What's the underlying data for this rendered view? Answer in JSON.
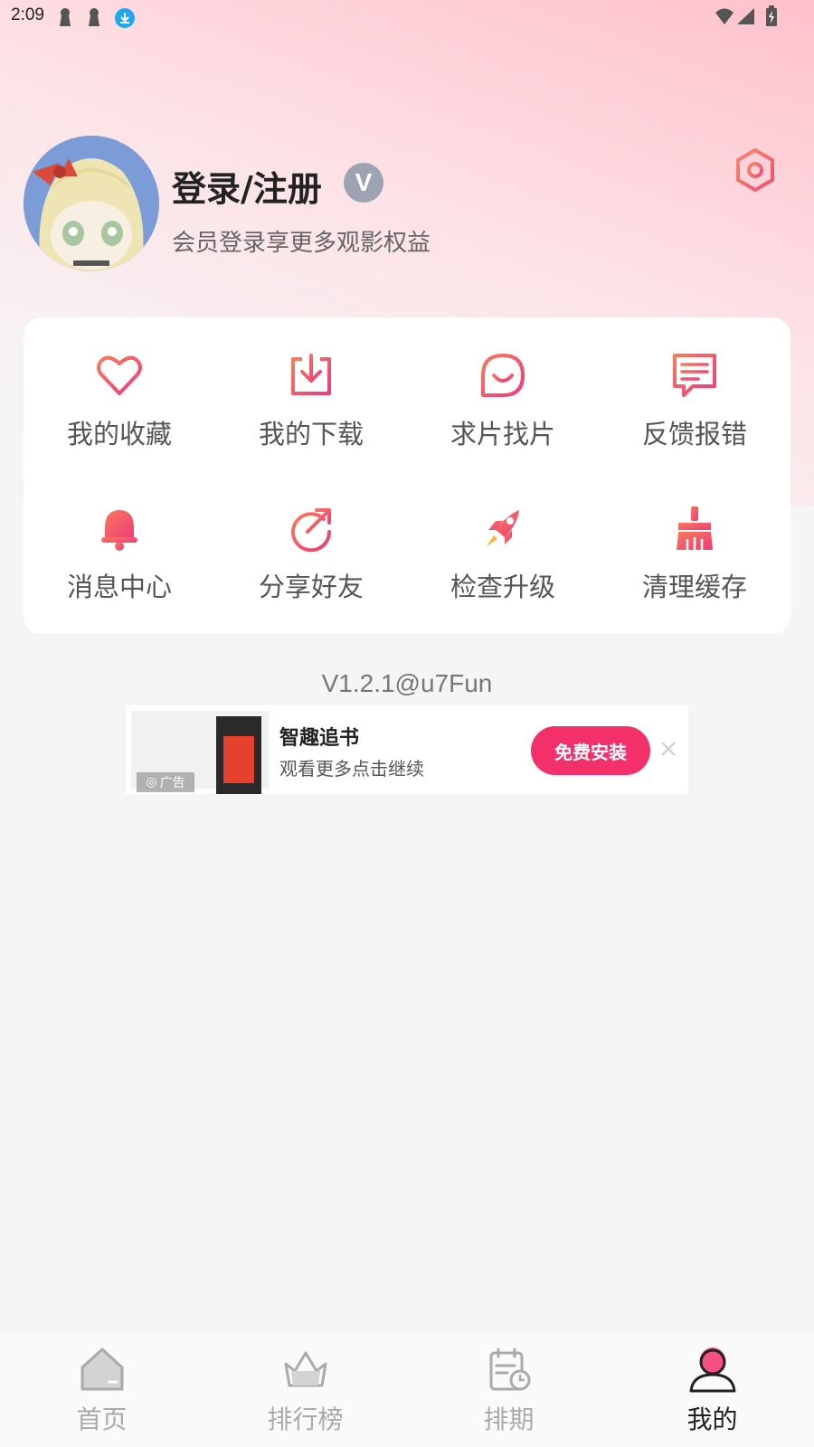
{
  "status_bar": {
    "time": "2:09"
  },
  "profile": {
    "login_label": "登录/注册",
    "vip_badge": "V",
    "subtitle": "会员登录享更多观影权益"
  },
  "menu": {
    "items": [
      {
        "label": "我的收藏",
        "icon": "heart-icon"
      },
      {
        "label": "我的下载",
        "icon": "download-icon"
      },
      {
        "label": "求片找片",
        "icon": "smile-chat-icon"
      },
      {
        "label": "反馈报错",
        "icon": "feedback-icon"
      },
      {
        "label": "消息中心",
        "icon": "bell-icon"
      },
      {
        "label": "分享好友",
        "icon": "share-icon"
      },
      {
        "label": "检查升级",
        "icon": "rocket-icon"
      },
      {
        "label": "清理缓存",
        "icon": "broom-icon"
      }
    ]
  },
  "version": "V1.2.1@u7Fun",
  "ad": {
    "tag": "广告",
    "title": "智趣追书",
    "description": "观看更多点击继续",
    "button": "免费安装"
  },
  "bottom_nav": {
    "items": [
      {
        "label": "首页",
        "icon": "home-icon",
        "active": false
      },
      {
        "label": "排行榜",
        "icon": "crown-icon",
        "active": false
      },
      {
        "label": "排期",
        "icon": "schedule-icon",
        "active": false
      },
      {
        "label": "我的",
        "icon": "profile-icon",
        "active": true
      }
    ]
  },
  "colors": {
    "accent": "#f4306b",
    "icon_gradient_start": "#f87a5c",
    "icon_gradient_end": "#f03a7a"
  }
}
